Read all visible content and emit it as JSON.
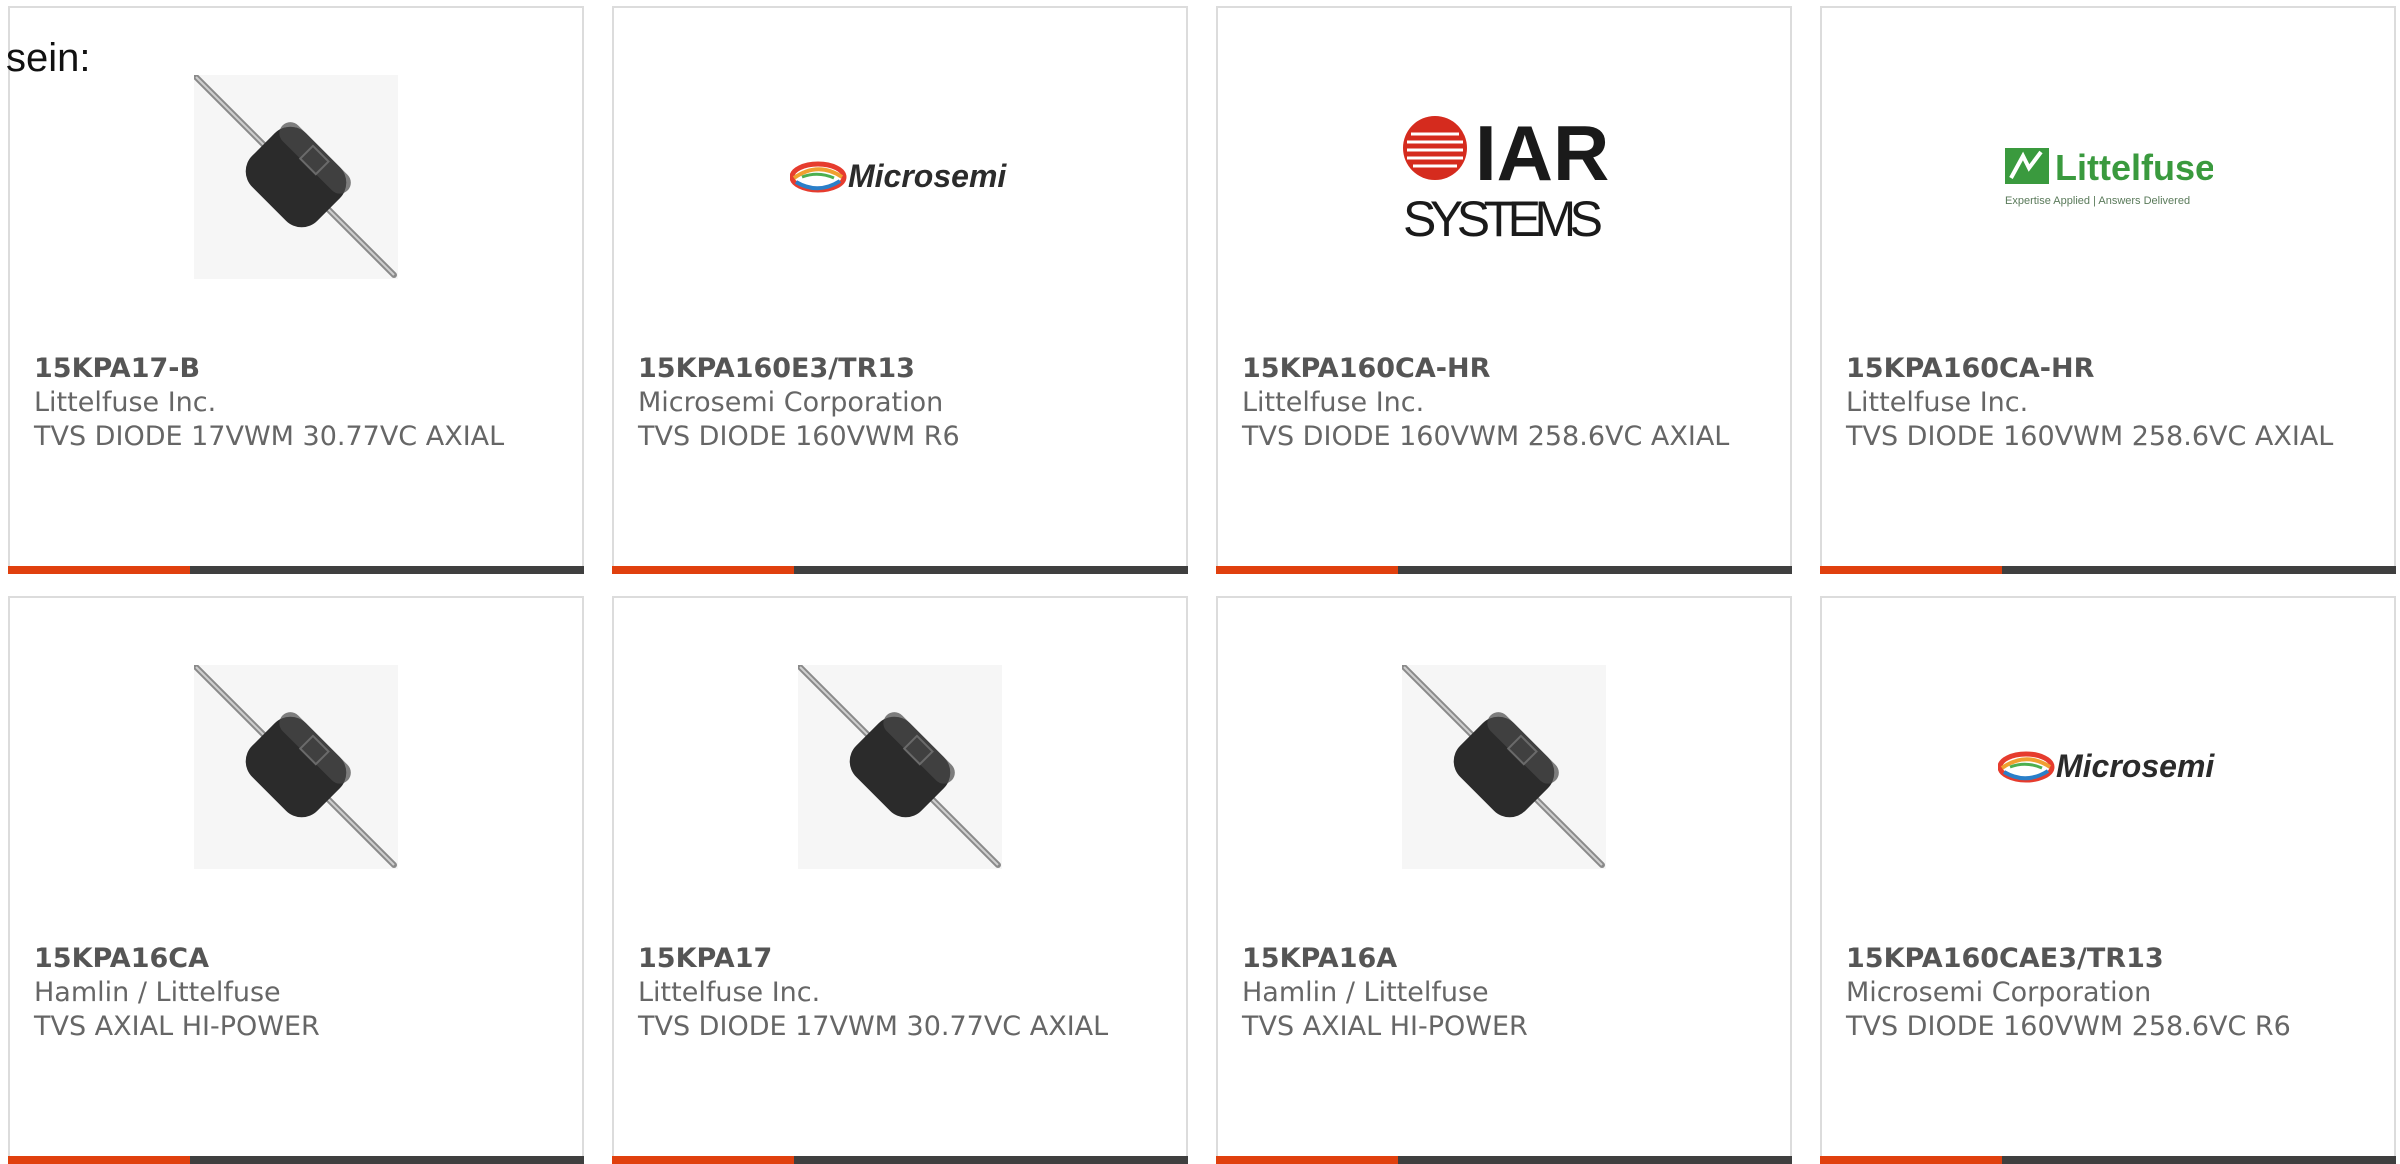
{
  "lead_text": "sein:",
  "colors": {
    "accent": "#e0400e",
    "bar": "#3f3f3f",
    "border": "#dcdcdc",
    "text": "#666666"
  },
  "cards": [
    {
      "part_number": "15KPA17-B",
      "manufacturer": "Littelfuse Inc.",
      "description": "TVS DIODE 17VWM 30.77VC AXIAL",
      "image": "diode-photo"
    },
    {
      "part_number": "15KPA160E3/TR13",
      "manufacturer": "Microsemi Corporation",
      "description": "TVS DIODE 160VWM R6",
      "image": "microsemi-logo",
      "logo_text": "Microsemi"
    },
    {
      "part_number": "15KPA160CA-HR",
      "manufacturer": "Littelfuse Inc.",
      "description": "TVS DIODE 160VWM 258.6VC AXIAL",
      "image": "iar-systems-logo",
      "logo_text_1": "IAR",
      "logo_text_2": "SYSTEMS"
    },
    {
      "part_number": "15KPA160CA-HR",
      "manufacturer": "Littelfuse Inc.",
      "description": "TVS DIODE 160VWM 258.6VC AXIAL",
      "image": "littelfuse-logo",
      "logo_text": "Littelfuse",
      "logo_tagline": "Expertise Applied | Answers Delivered"
    },
    {
      "part_number": "15KPA16CA",
      "manufacturer": "Hamlin / Littelfuse",
      "description": "TVS AXIAL HI-POWER",
      "image": "diode-photo"
    },
    {
      "part_number": "15KPA17",
      "manufacturer": "Littelfuse Inc.",
      "description": "TVS DIODE 17VWM 30.77VC AXIAL",
      "image": "diode-photo"
    },
    {
      "part_number": "15KPA16A",
      "manufacturer": "Hamlin / Littelfuse",
      "description": "TVS AXIAL HI-POWER",
      "image": "diode-photo"
    },
    {
      "part_number": "15KPA160CAE3/TR13",
      "manufacturer": "Microsemi Corporation",
      "description": "TVS DIODE 160VWM 258.6VC R6",
      "image": "microsemi-logo",
      "logo_text": "Microsemi"
    }
  ]
}
